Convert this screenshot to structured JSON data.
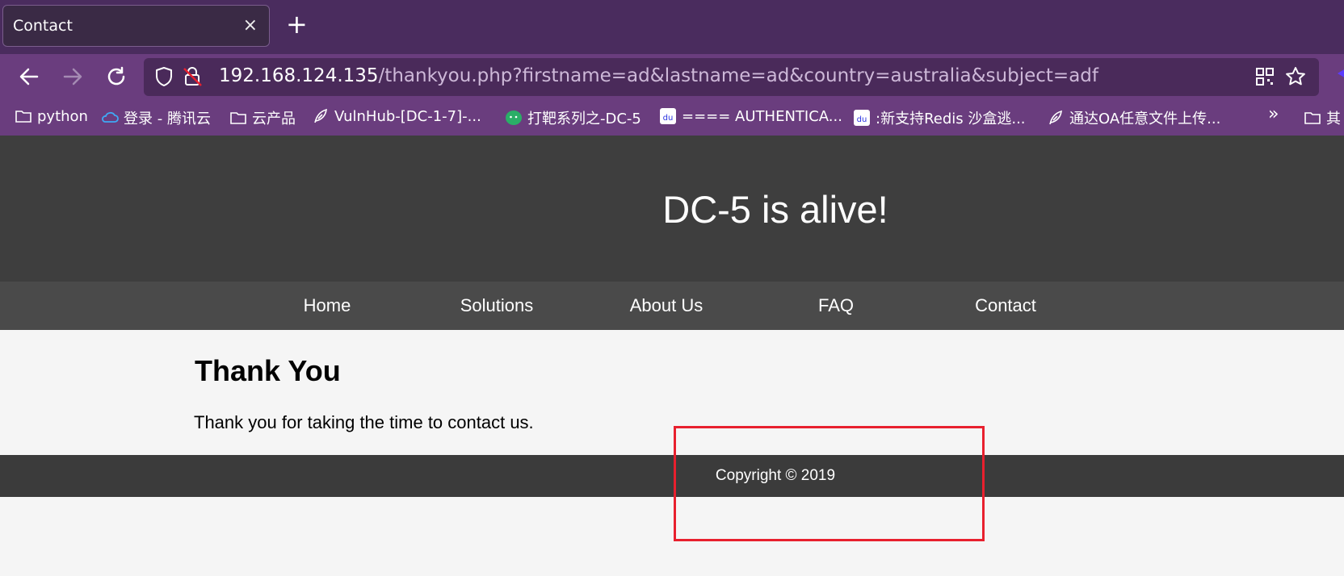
{
  "browser": {
    "tab_title": "Contact",
    "tab_close": "×",
    "new_tab": "+",
    "url_host": "192.168.124.135",
    "url_rest": "/thankyou.php?firstname=ad&lastname=ad&country=australia&subject=adf",
    "bookmarks": [
      {
        "label": "python",
        "icon": "folder-icon"
      },
      {
        "label": "登录 - 腾讯云",
        "icon": "cloud-icon"
      },
      {
        "label": "云产品",
        "icon": "folder-icon"
      },
      {
        "label": "VulnHub-[DC-1-7]-...",
        "icon": "feather-icon"
      },
      {
        "label": "打靶系列之-DC-5",
        "icon": "wechat-icon"
      },
      {
        "label": "==== AUTHENTICA...",
        "icon": "baidu-icon"
      },
      {
        "label": ":新支持Redis 沙盒逃...",
        "icon": "baidu-icon"
      },
      {
        "label": "通达OA任意文件上传...",
        "icon": "feather-icon"
      },
      {
        "label": "其",
        "icon": "folder-icon"
      }
    ],
    "overflow": "»"
  },
  "site": {
    "title": "DC-5 is alive!",
    "nav": [
      "Home",
      "Solutions",
      "About Us",
      "FAQ",
      "Contact"
    ],
    "heading": "Thank You",
    "message": "Thank you for taking the time to contact us.",
    "footer": "Copyright © 2019"
  },
  "colors": {
    "tabstrip": "#4a2c5e",
    "toolbar": "#6a3d7e",
    "header": "#3e3e3e",
    "nav": "#4a4a4a",
    "footer": "#3b3b3b",
    "annotation": "#e8202e"
  }
}
